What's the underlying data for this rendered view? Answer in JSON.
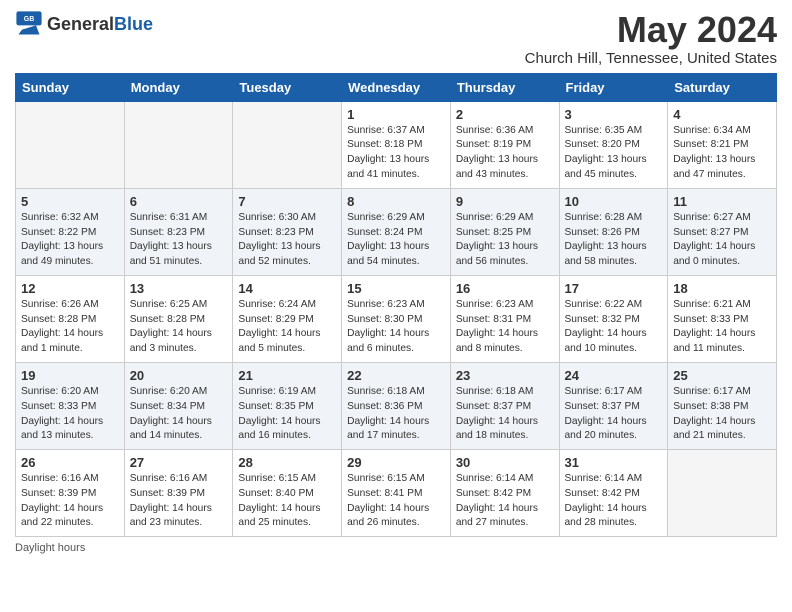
{
  "header": {
    "logo_general": "General",
    "logo_blue": "Blue",
    "month_title": "May 2024",
    "location": "Church Hill, Tennessee, United States"
  },
  "weekdays": [
    "Sunday",
    "Monday",
    "Tuesday",
    "Wednesday",
    "Thursday",
    "Friday",
    "Saturday"
  ],
  "weeks": [
    [
      {
        "day": "",
        "info": ""
      },
      {
        "day": "",
        "info": ""
      },
      {
        "day": "",
        "info": ""
      },
      {
        "day": "1",
        "info": "Sunrise: 6:37 AM\nSunset: 8:18 PM\nDaylight: 13 hours\nand 41 minutes."
      },
      {
        "day": "2",
        "info": "Sunrise: 6:36 AM\nSunset: 8:19 PM\nDaylight: 13 hours\nand 43 minutes."
      },
      {
        "day": "3",
        "info": "Sunrise: 6:35 AM\nSunset: 8:20 PM\nDaylight: 13 hours\nand 45 minutes."
      },
      {
        "day": "4",
        "info": "Sunrise: 6:34 AM\nSunset: 8:21 PM\nDaylight: 13 hours\nand 47 minutes."
      }
    ],
    [
      {
        "day": "5",
        "info": "Sunrise: 6:32 AM\nSunset: 8:22 PM\nDaylight: 13 hours\nand 49 minutes."
      },
      {
        "day": "6",
        "info": "Sunrise: 6:31 AM\nSunset: 8:23 PM\nDaylight: 13 hours\nand 51 minutes."
      },
      {
        "day": "7",
        "info": "Sunrise: 6:30 AM\nSunset: 8:23 PM\nDaylight: 13 hours\nand 52 minutes."
      },
      {
        "day": "8",
        "info": "Sunrise: 6:29 AM\nSunset: 8:24 PM\nDaylight: 13 hours\nand 54 minutes."
      },
      {
        "day": "9",
        "info": "Sunrise: 6:29 AM\nSunset: 8:25 PM\nDaylight: 13 hours\nand 56 minutes."
      },
      {
        "day": "10",
        "info": "Sunrise: 6:28 AM\nSunset: 8:26 PM\nDaylight: 13 hours\nand 58 minutes."
      },
      {
        "day": "11",
        "info": "Sunrise: 6:27 AM\nSunset: 8:27 PM\nDaylight: 14 hours\nand 0 minutes."
      }
    ],
    [
      {
        "day": "12",
        "info": "Sunrise: 6:26 AM\nSunset: 8:28 PM\nDaylight: 14 hours\nand 1 minute."
      },
      {
        "day": "13",
        "info": "Sunrise: 6:25 AM\nSunset: 8:28 PM\nDaylight: 14 hours\nand 3 minutes."
      },
      {
        "day": "14",
        "info": "Sunrise: 6:24 AM\nSunset: 8:29 PM\nDaylight: 14 hours\nand 5 minutes."
      },
      {
        "day": "15",
        "info": "Sunrise: 6:23 AM\nSunset: 8:30 PM\nDaylight: 14 hours\nand 6 minutes."
      },
      {
        "day": "16",
        "info": "Sunrise: 6:23 AM\nSunset: 8:31 PM\nDaylight: 14 hours\nand 8 minutes."
      },
      {
        "day": "17",
        "info": "Sunrise: 6:22 AM\nSunset: 8:32 PM\nDaylight: 14 hours\nand 10 minutes."
      },
      {
        "day": "18",
        "info": "Sunrise: 6:21 AM\nSunset: 8:33 PM\nDaylight: 14 hours\nand 11 minutes."
      }
    ],
    [
      {
        "day": "19",
        "info": "Sunrise: 6:20 AM\nSunset: 8:33 PM\nDaylight: 14 hours\nand 13 minutes."
      },
      {
        "day": "20",
        "info": "Sunrise: 6:20 AM\nSunset: 8:34 PM\nDaylight: 14 hours\nand 14 minutes."
      },
      {
        "day": "21",
        "info": "Sunrise: 6:19 AM\nSunset: 8:35 PM\nDaylight: 14 hours\nand 16 minutes."
      },
      {
        "day": "22",
        "info": "Sunrise: 6:18 AM\nSunset: 8:36 PM\nDaylight: 14 hours\nand 17 minutes."
      },
      {
        "day": "23",
        "info": "Sunrise: 6:18 AM\nSunset: 8:37 PM\nDaylight: 14 hours\nand 18 minutes."
      },
      {
        "day": "24",
        "info": "Sunrise: 6:17 AM\nSunset: 8:37 PM\nDaylight: 14 hours\nand 20 minutes."
      },
      {
        "day": "25",
        "info": "Sunrise: 6:17 AM\nSunset: 8:38 PM\nDaylight: 14 hours\nand 21 minutes."
      }
    ],
    [
      {
        "day": "26",
        "info": "Sunrise: 6:16 AM\nSunset: 8:39 PM\nDaylight: 14 hours\nand 22 minutes."
      },
      {
        "day": "27",
        "info": "Sunrise: 6:16 AM\nSunset: 8:39 PM\nDaylight: 14 hours\nand 23 minutes."
      },
      {
        "day": "28",
        "info": "Sunrise: 6:15 AM\nSunset: 8:40 PM\nDaylight: 14 hours\nand 25 minutes."
      },
      {
        "day": "29",
        "info": "Sunrise: 6:15 AM\nSunset: 8:41 PM\nDaylight: 14 hours\nand 26 minutes."
      },
      {
        "day": "30",
        "info": "Sunrise: 6:14 AM\nSunset: 8:42 PM\nDaylight: 14 hours\nand 27 minutes."
      },
      {
        "day": "31",
        "info": "Sunrise: 6:14 AM\nSunset: 8:42 PM\nDaylight: 14 hours\nand 28 minutes."
      },
      {
        "day": "",
        "info": ""
      }
    ]
  ],
  "footer": {
    "note": "Daylight hours"
  }
}
